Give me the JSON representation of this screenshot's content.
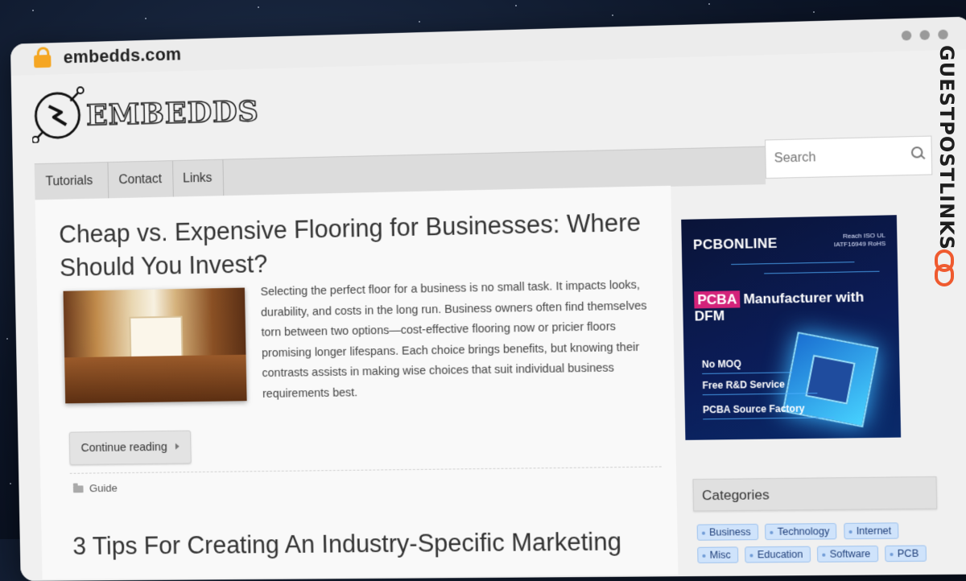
{
  "browser": {
    "url": "embedds.com"
  },
  "site": {
    "logo_text": "EMBEDDS",
    "nav": [
      {
        "label": "Tutorials",
        "has_dropdown": true
      },
      {
        "label": "Contact"
      },
      {
        "label": "Links"
      }
    ],
    "search": {
      "placeholder": "Search"
    }
  },
  "posts": [
    {
      "title": "Cheap vs. Expensive Flooring for Businesses: Where Should You Invest?",
      "excerpt": "Selecting the perfect floor for a business is no small task. It impacts looks, durability, and costs in the long run. Business owners often find themselves torn between two options—cost-effective flooring now or pricier floors promising longer lifespans. Each choice brings benefits, but knowing their contrasts assists in making wise choices that suit individual business requirements best.",
      "more_label": "Continue reading",
      "category": "Guide"
    },
    {
      "title": "3 Tips For Creating An Industry-Specific Marketing"
    }
  ],
  "sidebar": {
    "ad": {
      "brand": "PCBONLINE",
      "certs": [
        "Reach",
        "ISO",
        "UL",
        "IATF16949",
        "RoHS"
      ],
      "headline_highlight": "PCBA",
      "headline_rest": "Manufacturer with DFM",
      "features": [
        "No MOQ",
        "Free R&D Service",
        "PCBA Source Factory"
      ]
    },
    "categories": {
      "title": "Categories",
      "tags": [
        "Business",
        "Technology",
        "Internet",
        "Misc",
        "Education",
        "Software",
        "PCB"
      ]
    }
  },
  "watermark": {
    "text": "GUESTPOSTLINKS"
  },
  "colors": {
    "lock": "#f5a623",
    "ad_background": "#0b1c57",
    "ad_highlight": "#d4237a",
    "tag_background": "#cfe3fb",
    "badge_icon": "#ef5a2f"
  }
}
